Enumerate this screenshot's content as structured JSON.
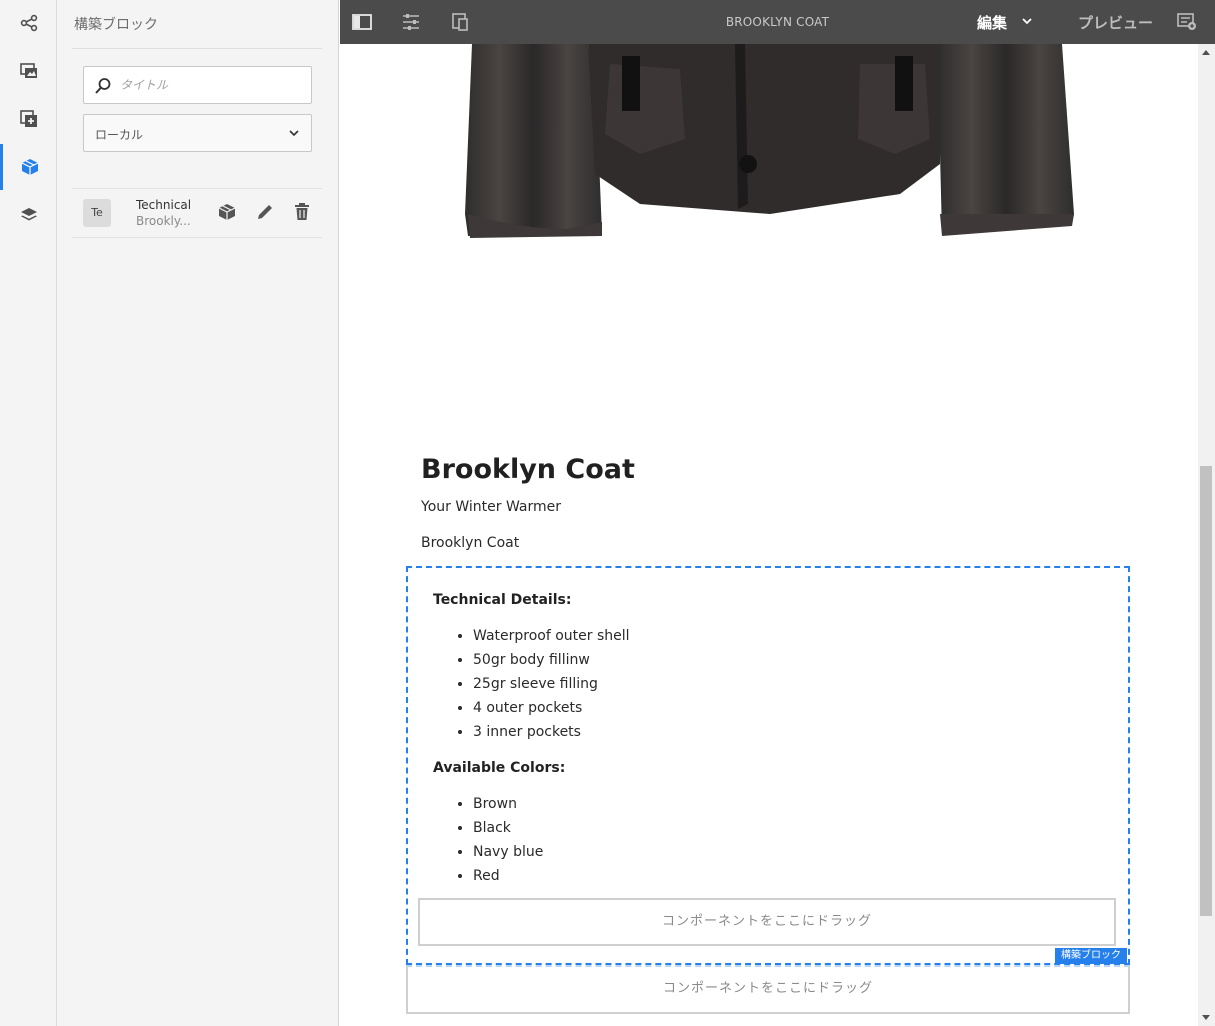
{
  "rail": {
    "items": [
      {
        "name": "share-icon"
      },
      {
        "name": "assets-icon"
      },
      {
        "name": "components-icon"
      },
      {
        "name": "building-blocks-icon"
      },
      {
        "name": "layers-icon"
      }
    ],
    "active_index": 3
  },
  "panel": {
    "title": "構築ブロック",
    "search": {
      "placeholder": "タイトル",
      "value": ""
    },
    "filter": {
      "selected": "ローカル"
    },
    "items": [
      {
        "thumb": "Te",
        "title": "Technical",
        "subtitle": "Brookly..."
      }
    ]
  },
  "topbar": {
    "page_title": "BROOKLYN COAT",
    "mode_label": "編集",
    "preview_label": "プレビュー"
  },
  "content": {
    "heading": "Brooklyn Coat",
    "subtitle": "Your Winter Warmer",
    "text": "Brooklyn Coat",
    "block": {
      "technical_heading": "Technical Details:",
      "technical_items": [
        "Waterproof outer shell",
        "50gr body fillinw",
        "25gr sleeve filling",
        "4 outer pockets",
        "3 inner pockets"
      ],
      "colors_heading": "Available Colors:",
      "color_items": [
        "Brown",
        "Black",
        "Navy blue",
        "Red"
      ],
      "dropzone_label": "コンポーネントをここにドラッグ",
      "tag_label": "構築ブロック"
    },
    "outer_dropzone_label": "コンポーネントをここにドラッグ"
  },
  "colors": {
    "accent": "#2680eb",
    "topbar_bg": "#4b4b4b",
    "panel_bg": "#f4f4f4"
  }
}
